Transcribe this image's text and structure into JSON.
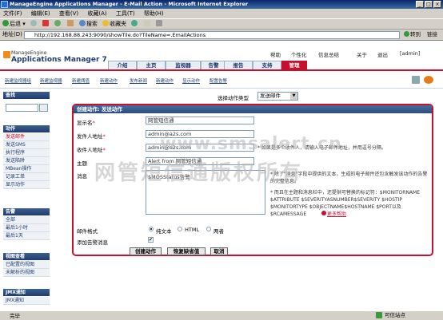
{
  "window": {
    "title": "ManageEngine Applications Manager - E-Mail Action - Microsoft Internet Explorer",
    "min": "_",
    "max": "□",
    "close": "×"
  },
  "menu": [
    "文件(F)",
    "编辑(E)",
    "查看(V)",
    "收藏(A)",
    "工具(T)",
    "帮助(H)"
  ],
  "toolbar": {
    "back": "后退",
    "search": "搜索",
    "favorites": "收藏夹"
  },
  "address": {
    "label": "地址(D)",
    "url": "http://192.168.88.243:9090/showTile.do?TileName=.EmailActions",
    "go": "转到",
    "links": "链接"
  },
  "status": {
    "left": "完毕",
    "right": "可信站点"
  },
  "app": {
    "brand_small": "ManageEngine",
    "brand_name": "Applications Manager 7",
    "top_links": [
      "帮助",
      "个性化",
      "信息总结",
      "关于",
      "退出",
      "[admin]"
    ],
    "tabs": [
      "介绍",
      "主页",
      "监视器",
      "告警",
      "报告",
      "支持",
      "管理"
    ],
    "active_tab": "管理",
    "subnav": [
      "新建监视器组",
      "新建监视器",
      "新建阈值",
      "新建动作",
      "发布新闻",
      "新建动作",
      "显示动作",
      "配置告警"
    ]
  },
  "sidebar": {
    "search_title": "查找",
    "actions_title": "动作",
    "actions": [
      "发送邮件",
      "发送SMS",
      "执行程序",
      "发送陷阱",
      "MBean操作",
      "记录工单",
      "显示动作"
    ],
    "alarms_title": "告警",
    "alarms": [
      "全部",
      "最后1小时",
      "最后1天"
    ],
    "views_title": "视图查看",
    "views": [
      "已配置的视图",
      "未解析的视图"
    ],
    "jmx_title": "JMX通知",
    "jmx": [
      "JMX通知"
    ]
  },
  "form": {
    "type_label": "选择动作类型",
    "type_value": "发送邮件",
    "panel_title": "创建动作: 发送动作",
    "name_label": "显示名",
    "name_value": "网管短信通",
    "from_label": "发件人地址",
    "from_value": "admin@a2s.com",
    "to_label": "收件人地址",
    "to_value": "admin@a2s.com",
    "to_help": "* 如果是多个收件人，请输入电子邮件地址，并用逗号分隔。",
    "subject_label": "主题",
    "subject_value": "Alert from 网管短信通",
    "message_label": "消息",
    "message_value": "$MOSStatus告警",
    "message_help": "* 除了\"消息\"字段中提供的文本，生成的电子邮件还包含触发该动作的告警的完整信息。",
    "vars_help": "* 而且在主题和消息栏中，还提供可替换的标记符：$MONITORNAME $ATTRIBUTE $SEVERITYASNUMBER$SEVERITY $HOSTIP $MONITORTYPE $OBJECTNAME$HOSTNAME $PORT以及 $RCAMESSAGE",
    "more_help": "更多帮助",
    "format_label": "邮件格式",
    "format_options": [
      "纯文本",
      "HTML",
      "两者"
    ],
    "format_selected": "纯文本",
    "append_label": "添加告警消息",
    "append_checked": true,
    "check_mark": "✔",
    "buttons": [
      "创建动作",
      "恢复缺省值",
      "取消"
    ]
  },
  "watermark": {
    "line1": "www.smsalert.cn",
    "line2": "网管短信通版权所有"
  }
}
